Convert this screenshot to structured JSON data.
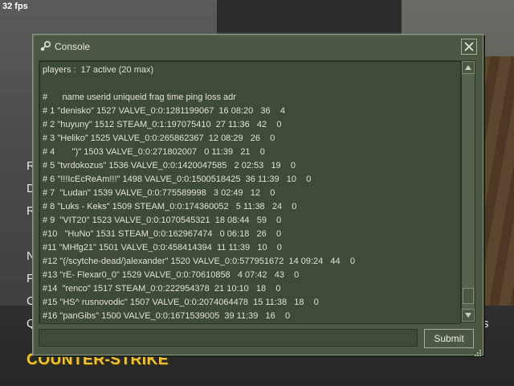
{
  "hud": {
    "fps": "32 fps"
  },
  "console": {
    "title": "Console",
    "lines": [
      "players :  17 active (20 max)",
      "",
      "#      name userid uniqueid frag time ping loss adr",
      "# 1 \"denisko\" 1527 VALVE_0:0:1281199067  16 08:20   36    4",
      "# 2 \"huyuny\" 1512 STEAM_0:1:197075410  27 11:36   42    0",
      "# 3 \"Heliko\" 1525 VALVE_0:0:265862367  12 08:29   26    0",
      "# 4       \")\" 1503 VALVE_0:0:271802007   0 11:39   21    0",
      "# 5 \"tvrdokozus\" 1536 VALVE_0:0:1420047585   2 02:53   19    0",
      "# 6 \"!!!IcEcReAm!!!\" 1498 VALVE_0:0:1500518425  36 11:39   10    0",
      "# 7  \"Ludan\" 1539 VALVE_0:0:775589998   3 02:49   12    0",
      "# 8 \"Luks - Keks\" 1509 STEAM_0:0:174360052   5 11:38   24    0",
      "# 9  \"VIT20\" 1523 VALVE_0:0:1070545321  18 08:44   59    0",
      "#10   \"HuNo\" 1531 STEAM_0:0:162967474   0 06:18   26    0",
      "#11 \"MHfg21\" 1501 VALVE_0:0:458414394  11 11:39   10    0",
      "#12 \"(/scytche-dead/)alexander\" 1520 VALVE_0:0:577951672  14 09:24   44    0",
      "#13 \"rE- Flexar0_0\" 1529 VALVE_0:0:70610858   4 07:42   43    0",
      "#14  \"renco\" 1517 STEAM_0:0:222954378  21 10:10   18    0",
      "#15 \"HS^ rusnovodic\" 1507 VALVE_0:0:2074064478  15 11:38   18    0",
      "#16 \"panGibs\" 1500 VALVE_0:0:1671539005  39 11:39   16    0"
    ],
    "input_value": "",
    "submit_label": "Submit",
    "icons": {
      "title": "steam-icon",
      "close": "close-icon",
      "scroll_up": "arrow-up-icon",
      "scroll_down": "arrow-down-icon",
      "resize": "resize-grip-icon"
    }
  },
  "background": {
    "menu_letters": [
      "R",
      "D",
      "R",
      "N",
      "F",
      "C",
      "Q"
    ],
    "logo": "COUNTER-STRIKE",
    "fragment_right": "s"
  },
  "colors": {
    "panel": "#4c5844",
    "output_bg": "#3f4a39",
    "text": "#dfe3d6",
    "logo": "#f2c230"
  }
}
